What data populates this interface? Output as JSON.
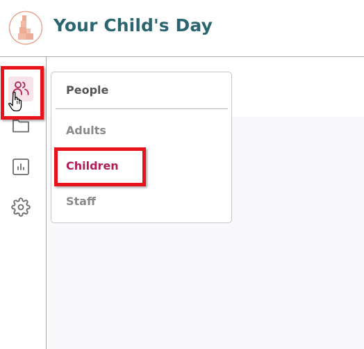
{
  "header": {
    "title": "Your Child's Day",
    "logo_icon": "stacked-blocks-logo"
  },
  "sidebar": {
    "items": [
      {
        "name": "people",
        "icon": "people-icon",
        "active": true
      },
      {
        "name": "folder",
        "icon": "folder-icon"
      },
      {
        "name": "reports",
        "icon": "bar-chart-icon"
      },
      {
        "name": "settings",
        "icon": "gear-icon"
      }
    ]
  },
  "people_menu": {
    "header": "People",
    "items": [
      {
        "label": "Adults"
      },
      {
        "label": "Children",
        "active": true
      },
      {
        "label": "Staff"
      }
    ]
  },
  "colors": {
    "brand_title": "#2b6670",
    "accent": "#b01e55",
    "highlight": "#e8121a",
    "logo_peach": "#e8a48d"
  }
}
